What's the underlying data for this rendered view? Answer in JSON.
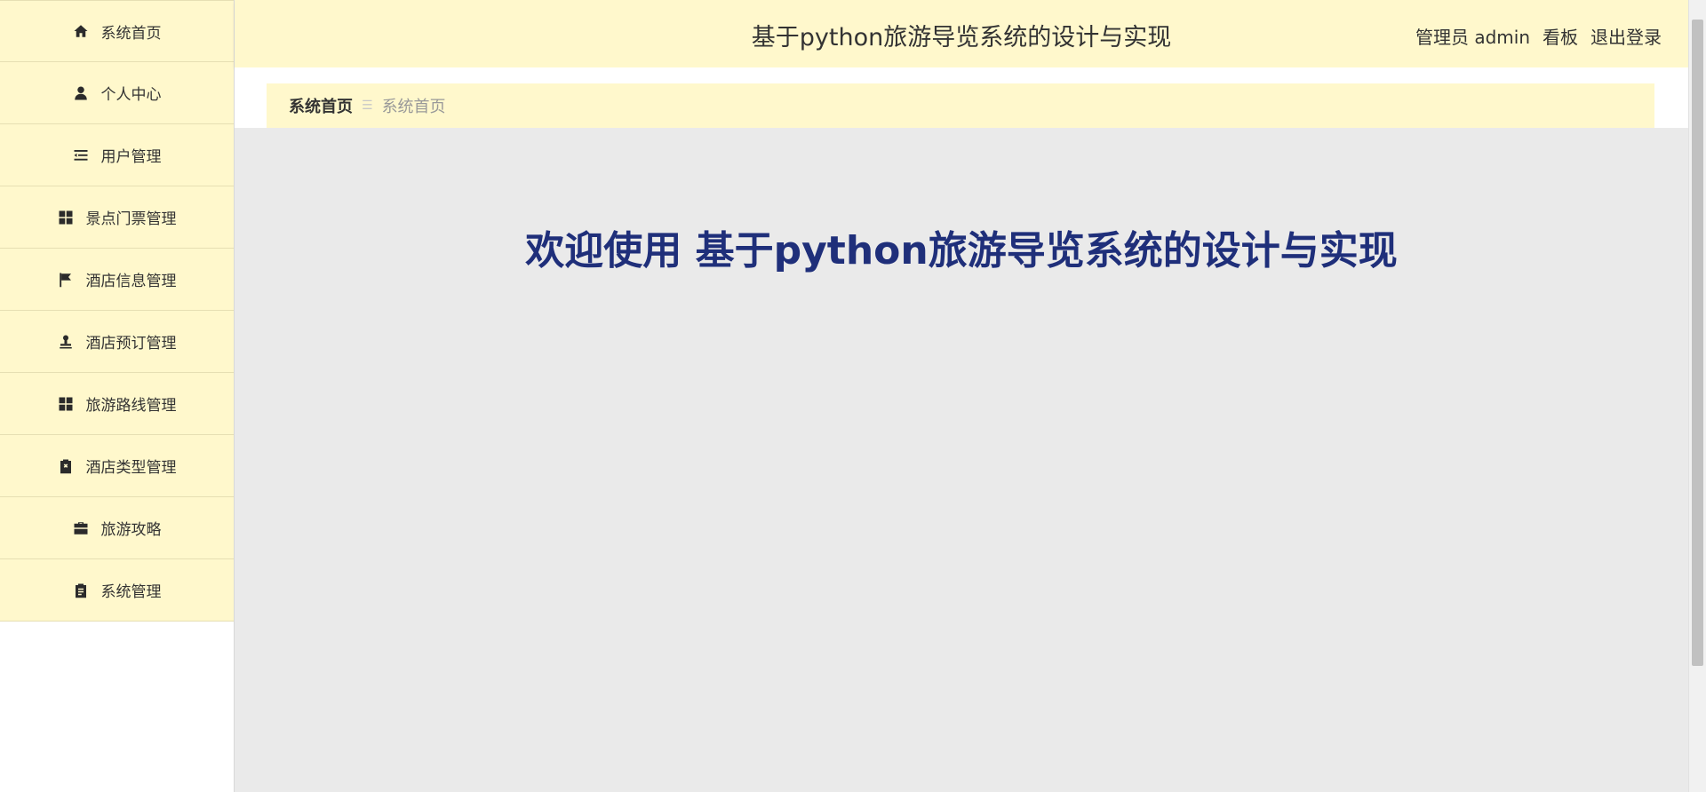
{
  "sidebar": {
    "items": [
      {
        "label": "系统首页",
        "icon": "home-icon"
      },
      {
        "label": "个人中心",
        "icon": "user-icon"
      },
      {
        "label": "用户管理",
        "icon": "list-icon"
      },
      {
        "label": "景点门票管理",
        "icon": "grid-icon"
      },
      {
        "label": "酒店信息管理",
        "icon": "flag-icon"
      },
      {
        "label": "酒店预订管理",
        "icon": "stamp-icon"
      },
      {
        "label": "旅游路线管理",
        "icon": "grid-icon"
      },
      {
        "label": "酒店类型管理",
        "icon": "clipboard-x-icon"
      },
      {
        "label": "旅游攻略",
        "icon": "briefcase-icon"
      },
      {
        "label": "系统管理",
        "icon": "clipboard-icon"
      }
    ]
  },
  "header": {
    "title": "基于python旅游导览系统的设计与实现",
    "user": "管理员 admin",
    "board_link": "看板",
    "logout_link": "退出登录"
  },
  "breadcrumb": {
    "home": "系统首页",
    "separator": "☰",
    "current": "系统首页"
  },
  "main": {
    "welcome": "欢迎使用 基于python旅游导览系统的设计与实现"
  },
  "colors": {
    "accent_bg": "#fff8cc",
    "content_bg": "#eaeaea",
    "welcome_text": "#1f2f7a"
  }
}
